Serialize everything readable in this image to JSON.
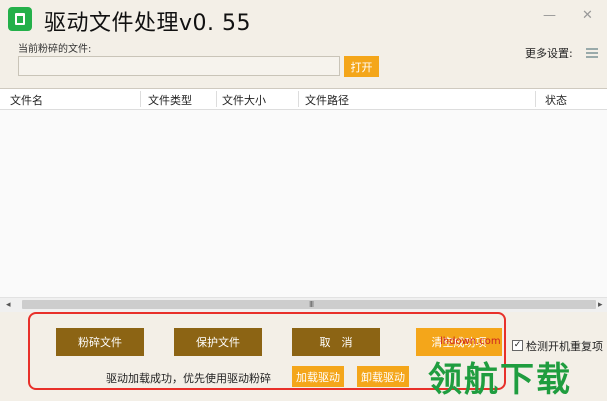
{
  "app": {
    "title": "驱动文件处理v0. 55",
    "minimize_glyph": "—",
    "close_glyph": "✕"
  },
  "file_section": {
    "label": "当前粉碎的文件:",
    "input_value": "",
    "open_button": "打开"
  },
  "settings": {
    "more_label": "更多设置:"
  },
  "table": {
    "columns": [
      "文件名",
      "文件类型",
      "文件大小",
      "文件路径",
      "状态"
    ],
    "rows": [],
    "scroll_left": "◂",
    "scroll_right": "▸",
    "scroll_grip": "III"
  },
  "actions": {
    "shred": "粉碎文件",
    "protect": "保护文件",
    "cancel": "取　消",
    "clear": "清空成功项",
    "load_driver": "加载驱动",
    "unload_driver": "卸载驱动"
  },
  "status": {
    "message": "驱动加载成功，优先使用驱动粉碎"
  },
  "options": {
    "check_label": "检测开机重复项",
    "check_checked": true,
    "check_mark": "✓"
  },
  "watermark": {
    "site": "lhdown.com",
    "brand": "领航下载"
  },
  "colors": {
    "accent_orange": "#f4a61a",
    "button_brown": "#8c6414",
    "frame_red": "#e8302a",
    "app_icon_green": "#24b04a"
  }
}
